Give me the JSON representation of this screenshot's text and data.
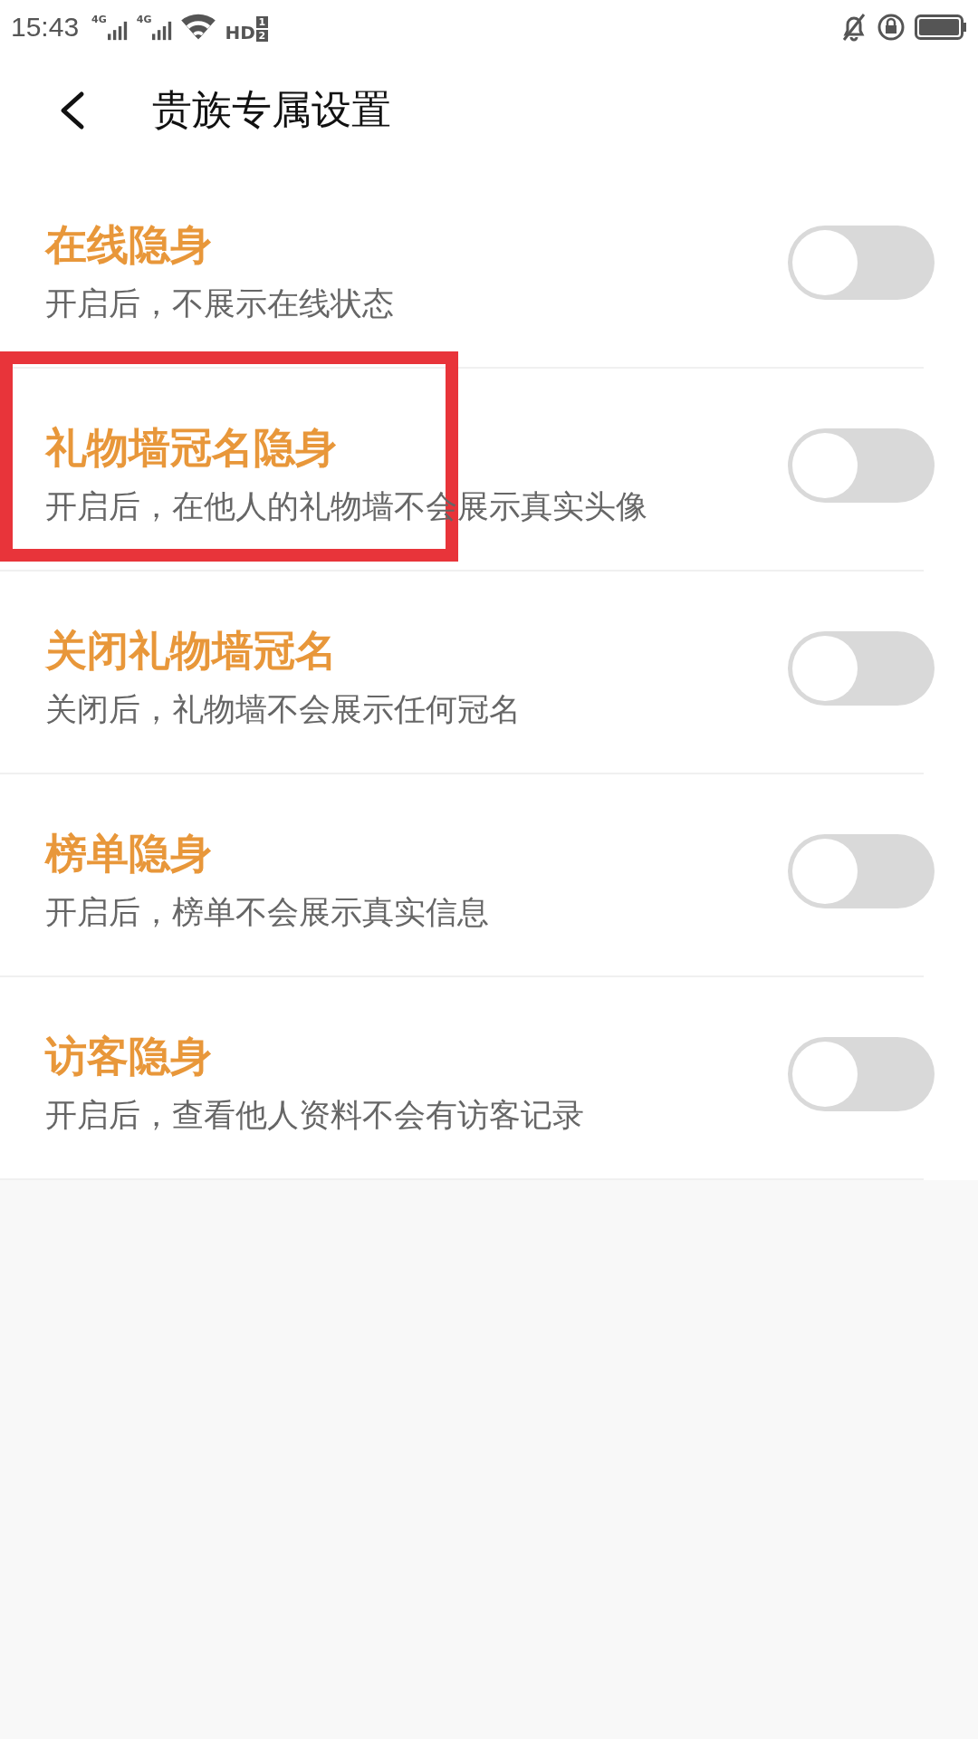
{
  "status_bar": {
    "time": "15:43",
    "signals": [
      {
        "label": "4G"
      },
      {
        "label": "4G"
      }
    ],
    "hd": {
      "label": "HD",
      "slots": [
        "1",
        "2"
      ]
    }
  },
  "header": {
    "title": "贵族专属设置"
  },
  "settings": [
    {
      "title": "在线隐身",
      "subtitle": "开启后，不展示在线状态",
      "on": false,
      "highlighted": false
    },
    {
      "title": "礼物墙冠名隐身",
      "subtitle": "开启后，在他人的礼物墙不会展示真实头像",
      "on": false,
      "highlighted": true
    },
    {
      "title": "关闭礼物墙冠名",
      "subtitle": "关闭后，礼物墙不会展示任何冠名",
      "on": false,
      "highlighted": false
    },
    {
      "title": "榜单隐身",
      "subtitle": "开启后，榜单不会展示真实信息",
      "on": false,
      "highlighted": false
    },
    {
      "title": "访客隐身",
      "subtitle": "开启后，查看他人资料不会有访客记录",
      "on": false,
      "highlighted": false
    }
  ]
}
